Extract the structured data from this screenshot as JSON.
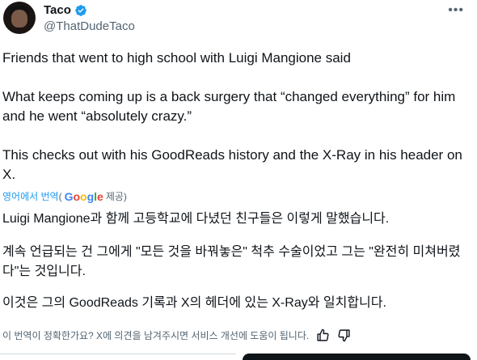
{
  "author": {
    "display_name": "Taco",
    "handle": "@ThatDudeTaco",
    "verified": true,
    "avatar": "profile-photo-dark"
  },
  "more_icon": "more-horizontal-icon",
  "tweet": {
    "paragraph_1": "Friends that went to high school with Luigi Mangione said",
    "paragraph_2": "What keeps coming up is a back surgery that “changed everything” for him and he went “absolutely crazy.”",
    "paragraph_3": "This checks out with his GoodReads history and the X-Ray in his header on X."
  },
  "translation": {
    "translated_from_label": "영어에서 번역",
    "open_paren": "(",
    "provider_g1": "G",
    "provider_g2": "o",
    "provider_g3": "o",
    "provider_g4": "g",
    "provider_g5": "l",
    "provider_g6": "e",
    "provider_suffix": "제공)",
    "paragraph_1": "Luigi Mangione과 함께 고등학교에 다녔던 친구들은 이렇게 말했습니다.",
    "paragraph_2": "계속 언급되는 건 그에게 \"모든 것을 바꿔놓은\" 척추 수술이었고 그는 \"완전히 미쳐버렸다\"는 것입니다.",
    "paragraph_3": "이것은 그의 GoodReads 기록과 X의 헤더에 있는 X-Ray와 일치합니다.",
    "feedback_prompt": "이 번역이 정확한가요? X에 의견을 남겨주시면 서비스 개선에 도움이 됩니다.",
    "thumbs_up_icon": "thumbs-up-icon",
    "thumbs_down_icon": "thumbs-down-icon"
  },
  "colors": {
    "link_blue": "#1d9bf0",
    "secondary_text": "#536471",
    "primary_text": "#0f1419",
    "verified_blue": "#1d9bf0"
  }
}
